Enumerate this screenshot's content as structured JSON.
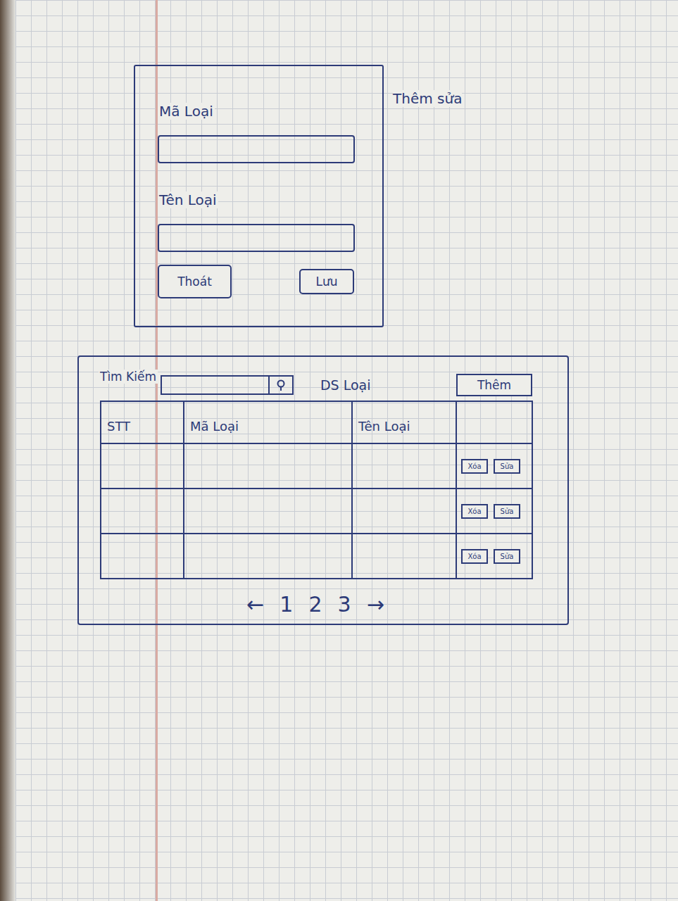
{
  "form": {
    "title": "Thêm sửa",
    "fields": [
      {
        "label": "Mã Loại",
        "value": ""
      },
      {
        "label": "Tên Loại",
        "value": ""
      }
    ],
    "buttons": [
      "Thoát",
      "Lưu"
    ]
  },
  "list": {
    "search_label": "Tìm Kiếm",
    "title": "DS Loại",
    "add_button": "Thêm",
    "columns": [
      "STT",
      "Mã Loại",
      "Tên Loại"
    ],
    "rows": [
      {
        "actions": [
          "Xóa",
          "Sửa"
        ]
      },
      {
        "actions": [
          "Xóa",
          "Sửa"
        ]
      },
      {
        "actions": [
          "Xóa",
          "Sửa"
        ]
      }
    ],
    "pagination": [
      "←",
      "1",
      "2",
      "3",
      "→"
    ]
  }
}
